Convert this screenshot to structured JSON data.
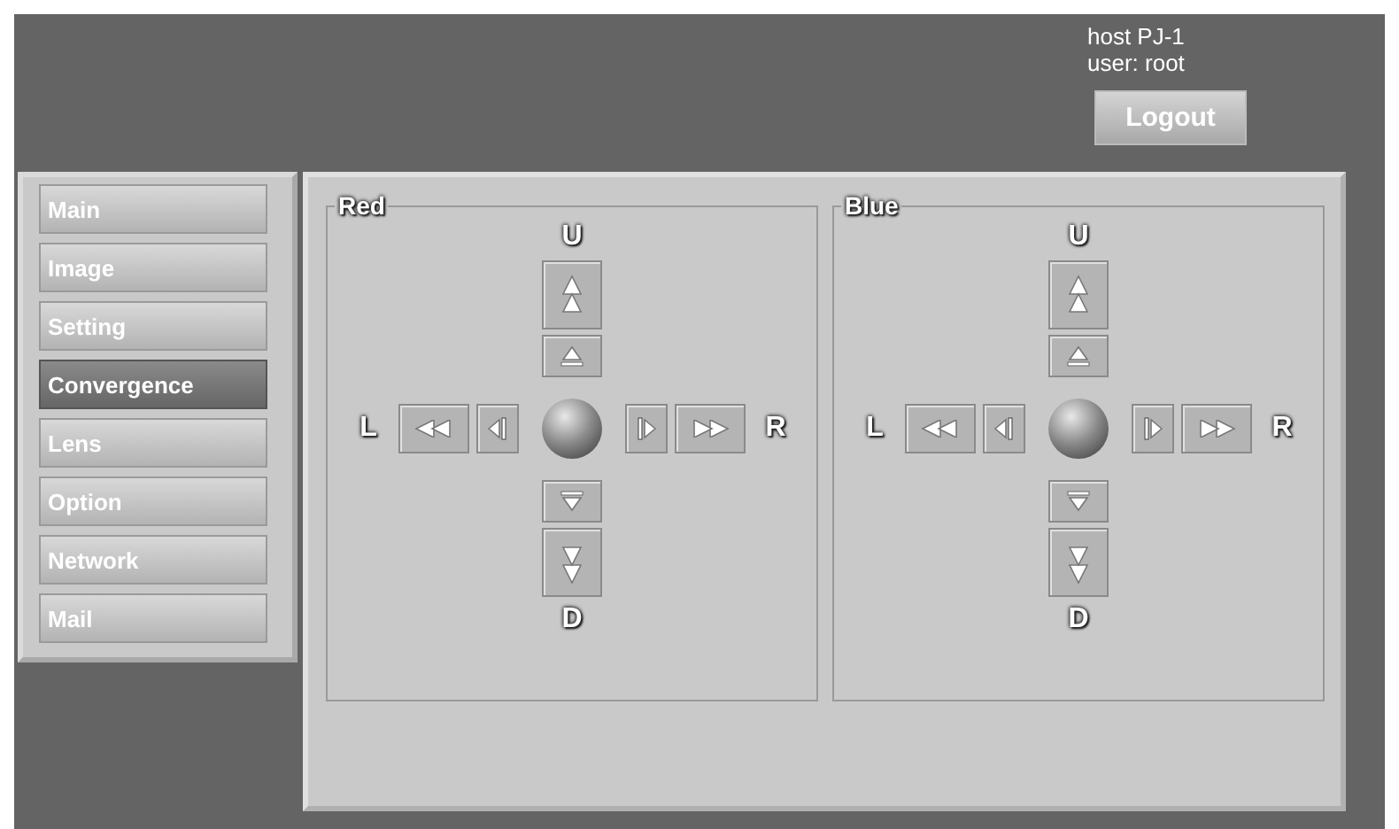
{
  "header": {
    "host": "host PJ-1",
    "user": "user: root",
    "logout": "Logout"
  },
  "menu": [
    {
      "label": "Main",
      "selected": false
    },
    {
      "label": "Image",
      "selected": false
    },
    {
      "label": "Setting",
      "selected": false
    },
    {
      "label": "Convergence",
      "selected": true
    },
    {
      "label": "Lens",
      "selected": false
    },
    {
      "label": "Option",
      "selected": false
    },
    {
      "label": "Network",
      "selected": false
    },
    {
      "label": "Mail",
      "selected": false
    }
  ],
  "groups": [
    {
      "title": "Red",
      "up": "U",
      "down": "D",
      "left": "L",
      "right": "R"
    },
    {
      "title": "Blue",
      "up": "U",
      "down": "D",
      "left": "L",
      "right": "R"
    }
  ]
}
